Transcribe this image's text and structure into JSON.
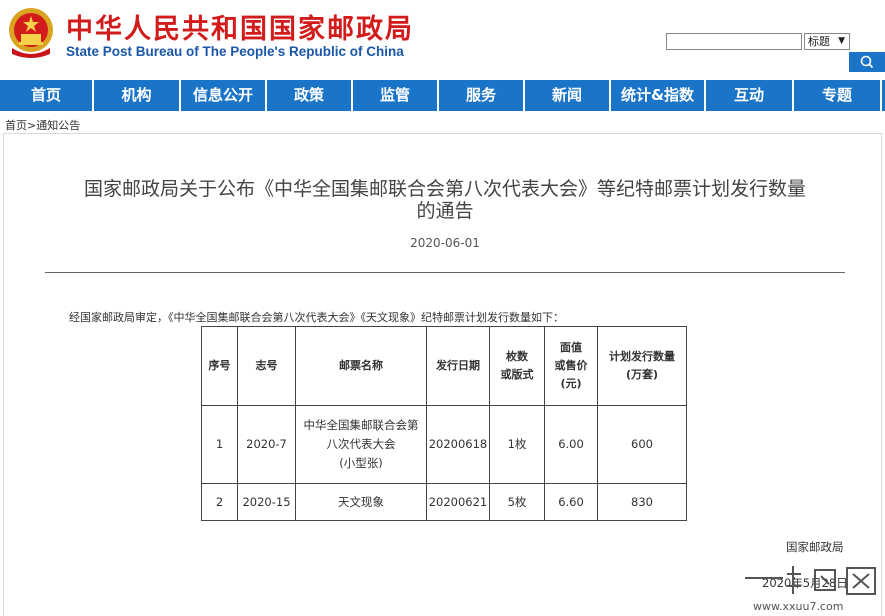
{
  "header": {
    "title": "中华人民共和国国家邮政局",
    "subtitle": "State Post Bureau of The People's Republic of China",
    "search": {
      "placeholder": "",
      "select_value": "标题"
    }
  },
  "nav": {
    "items": [
      "首页",
      "机构",
      "信息公开",
      "政策",
      "监管",
      "服务",
      "新闻",
      "统计&指数",
      "互动",
      "专题"
    ]
  },
  "breadcrumb": {
    "home": "首页",
    "sep": ">",
    "current": "通知公告"
  },
  "article": {
    "title_line1": "国家邮政局关于公布《中华全国集邮联合会第八次代表大会》等纪特邮票计划发行数量",
    "title_line2": "的通告",
    "date": "2020-06-01",
    "intro": "经国家邮政局审定，《中华全国集邮联合会第八次代表大会》《天文现象》纪特邮票计划发行数量如下：",
    "table": {
      "headers": [
        [
          "序号"
        ],
        [
          "志号"
        ],
        [
          "邮票名称"
        ],
        [
          "发行日期"
        ],
        [
          "枚数",
          "或版式"
        ],
        [
          "面值",
          "或售价",
          "(元)"
        ],
        [
          "计划发行数量",
          "(万套)"
        ]
      ],
      "rows": [
        {
          "no": "1",
          "code": "2020-7",
          "name_lines": [
            "中华全国集邮联合会第",
            "八次代表大会",
            "(小型张)"
          ],
          "date": "20200618",
          "count": "1枚",
          "price": "6.00",
          "quantity": "600"
        },
        {
          "no": "2",
          "code": "2020-15",
          "name_lines": [
            "天文现象"
          ],
          "date": "20200621",
          "count": "5枚",
          "price": "6.60",
          "quantity": "830"
        }
      ]
    },
    "signer": "国家邮政局",
    "sign_date": "2020年5月28日"
  },
  "watermark": {
    "text": "www.xxuu7.com"
  },
  "colors": {
    "nav_bg": "#1a75c9",
    "title_red": "#d21c1c",
    "subtitle_blue": "#1a57a8"
  }
}
